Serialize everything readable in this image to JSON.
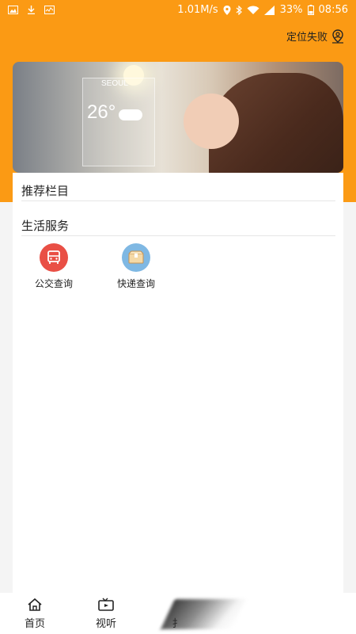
{
  "status_bar": {
    "speed": "1.01M/s",
    "battery": "33%",
    "time": "08:56"
  },
  "location": {
    "label": "定位失败",
    "icon": "location-person-icon"
  },
  "banner": {
    "city": "SEOUL",
    "temperature": "26°"
  },
  "sections": {
    "recommended": {
      "title": "推荐栏目"
    },
    "life_services": {
      "title": "生活服务",
      "items": [
        {
          "label": "公交查询",
          "icon": "bus-icon",
          "color": "#e94f45"
        },
        {
          "label": "快递查询",
          "icon": "package-icon",
          "color": "#7fb8e3"
        }
      ]
    }
  },
  "tabbar": {
    "tabs": [
      {
        "label": "首页",
        "icon": "home-icon"
      },
      {
        "label": "视听",
        "icon": "tv-icon"
      },
      {
        "label": "扌",
        "icon": ""
      }
    ]
  },
  "colors": {
    "accent": "#fb9a14"
  }
}
